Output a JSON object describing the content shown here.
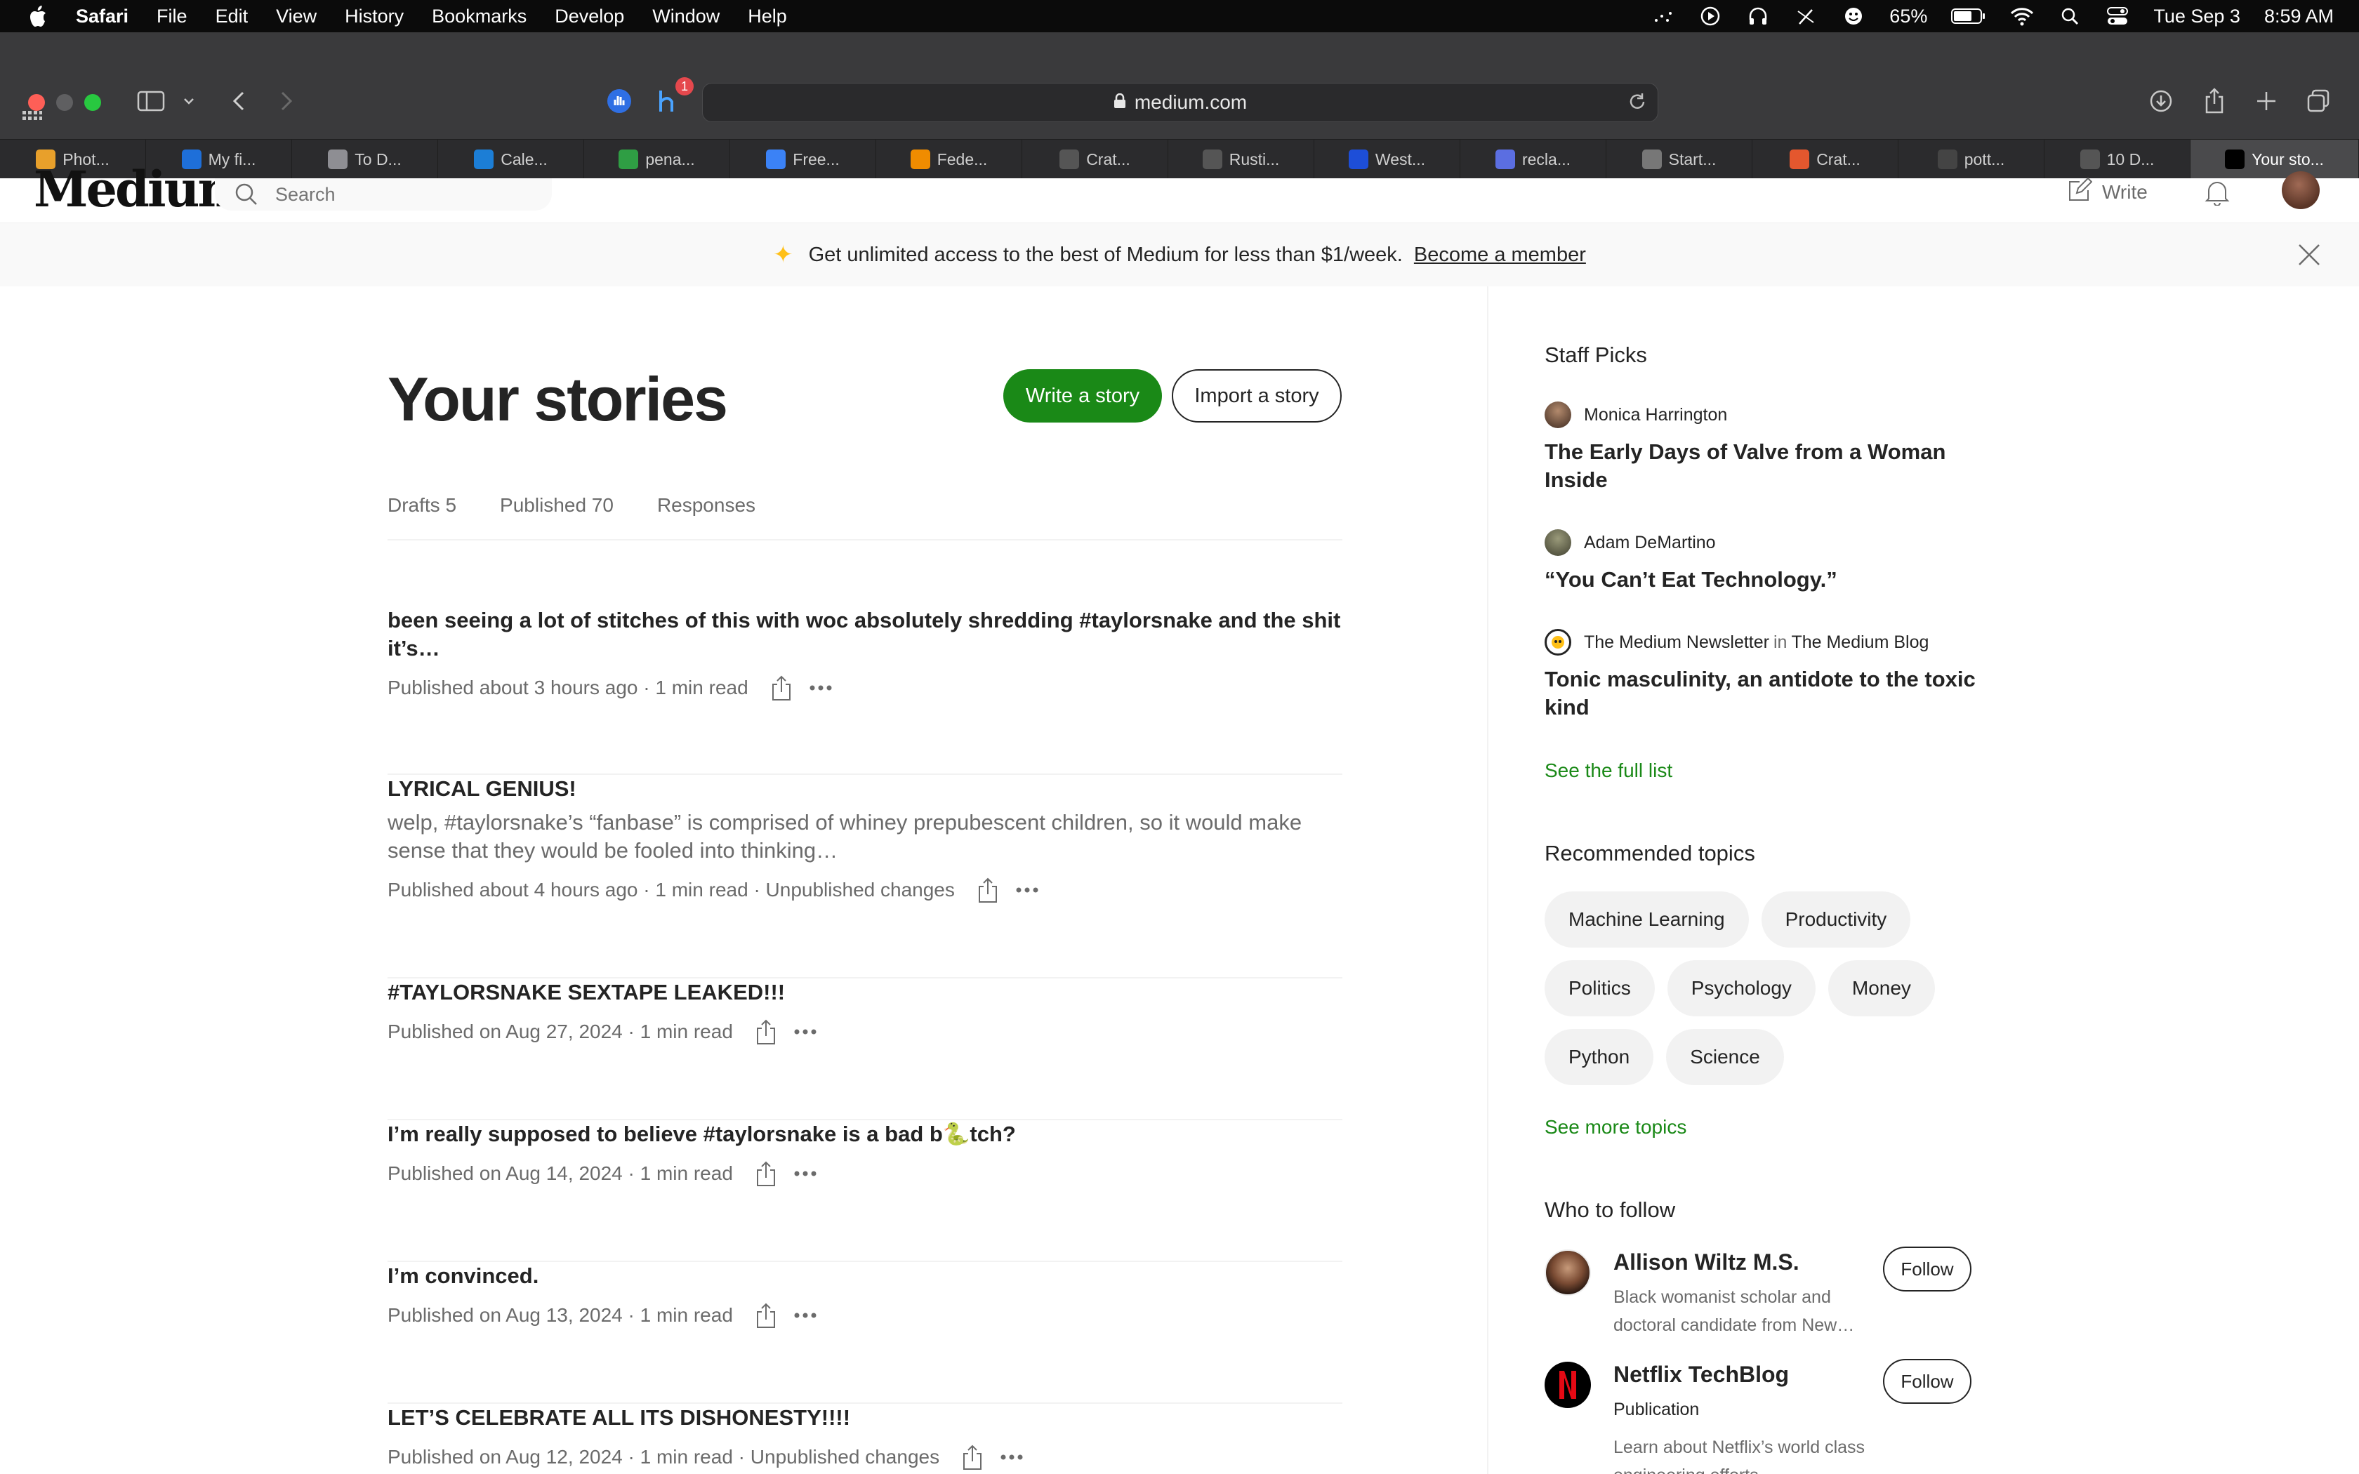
{
  "menubar": {
    "app": "Safari",
    "items": [
      "File",
      "Edit",
      "View",
      "History",
      "Bookmarks",
      "Develop",
      "Window",
      "Help"
    ],
    "battery": "65%",
    "date": "Tue Sep 3",
    "time": "8:59 AM"
  },
  "browser": {
    "url": "medium.com",
    "extension_badge": "1"
  },
  "tabs": [
    {
      "label": "Phot...",
      "color": "#e8a02b"
    },
    {
      "label": "My fi...",
      "color": "#1e6fd9"
    },
    {
      "label": "To D...",
      "color": "#8e8e93"
    },
    {
      "label": "Cale...",
      "color": "#1c7ed6"
    },
    {
      "label": "pena...",
      "color": "#2f9e44"
    },
    {
      "label": "Free...",
      "color": "#3b82f6"
    },
    {
      "label": "Fede...",
      "color": "#f08c00"
    },
    {
      "label": "Crat...",
      "color": "#555555"
    },
    {
      "label": "Rusti...",
      "color": "#555555"
    },
    {
      "label": "West...",
      "color": "#1d4ed8"
    },
    {
      "label": "recla...",
      "color": "#5b6ee1"
    },
    {
      "label": "Start...",
      "color": "#777777"
    },
    {
      "label": "Crat...",
      "color": "#e4572e"
    },
    {
      "label": "pott...",
      "color": "#444444"
    },
    {
      "label": "10 D...",
      "color": "#555555"
    },
    {
      "label": "Your sto...",
      "color": "#000000"
    }
  ],
  "medium": {
    "logo": "Medium",
    "search_placeholder": "Search",
    "write_label": "Write"
  },
  "banner": {
    "text": "Get unlimited access to the best of Medium for less than $1/week.",
    "link": "Become a member"
  },
  "main": {
    "title": "Your stories",
    "write_button": "Write a story",
    "import_button": "Import a story",
    "tabs": [
      "Drafts 5",
      "Published 70",
      "Responses"
    ],
    "stories": [
      {
        "title": "been seeing a lot of stitches of this with woc absolutely shredding #taylorsnake and the shit it’s…",
        "excerpt": "",
        "meta": "Published about 3 hours ago · 1 min read"
      },
      {
        "title": "LYRICAL GENIUS!",
        "excerpt": "welp, #taylorsnake’s “fanbase” is comprised of whiney prepubescent children, so it would make sense that they would be fooled into thinking…",
        "meta": "Published about 4 hours ago · 1 min read · Unpublished changes"
      },
      {
        "title": "#TAYLORSNAKE SEXTAPE LEAKED!!!",
        "excerpt": "",
        "meta": "Published on Aug 27, 2024 · 1 min read"
      },
      {
        "title": "I’m really supposed to believe #taylorsnake is a bad b🐍tch?",
        "excerpt": "",
        "meta": "Published on Aug 14, 2024 · 1 min read"
      },
      {
        "title": "I’m convinced.",
        "excerpt": "",
        "meta": "Published on Aug 13, 2024 · 1 min read"
      },
      {
        "title": "LET’S CELEBRATE ALL ITS DISHONESTY!!!!",
        "excerpt": "",
        "meta": "Published on Aug 12, 2024 · 1 min read · Unpublished changes"
      }
    ]
  },
  "sidebar": {
    "staff_picks_heading": "Staff Picks",
    "picks": [
      {
        "author": "Monica Harrington",
        "in_label": "",
        "publication": "",
        "title": "The Early Days of Valve from a Woman Inside"
      },
      {
        "author": "Adam DeMartino",
        "in_label": "",
        "publication": "",
        "title": "“You Can’t Eat Technology.”"
      },
      {
        "author": "The Medium Newsletter",
        "in_label": "in",
        "publication": "The Medium Blog",
        "title": "Tonic masculinity, an antidote to the toxic kind"
      }
    ],
    "see_full_list": "See the full list",
    "topics_heading": "Recommended topics",
    "topics": [
      "Machine Learning",
      "Productivity",
      "Politics",
      "Psychology",
      "Money",
      "Python",
      "Science"
    ],
    "see_more_topics": "See more topics",
    "follow_heading": "Who to follow",
    "follow": [
      {
        "name": "Allison Wiltz M.S.",
        "desc": "Black womanist scholar and doctoral candidate from New…",
        "button": "Follow"
      },
      {
        "name": "Netflix TechBlog",
        "desc": "Publication",
        "desc2": "Learn about Netflix’s world class engineering efforts…",
        "button": "Follow"
      }
    ]
  },
  "colors": {
    "accent_green": "#1a8917",
    "text": "#242424",
    "muted": "#6b6b6b"
  }
}
